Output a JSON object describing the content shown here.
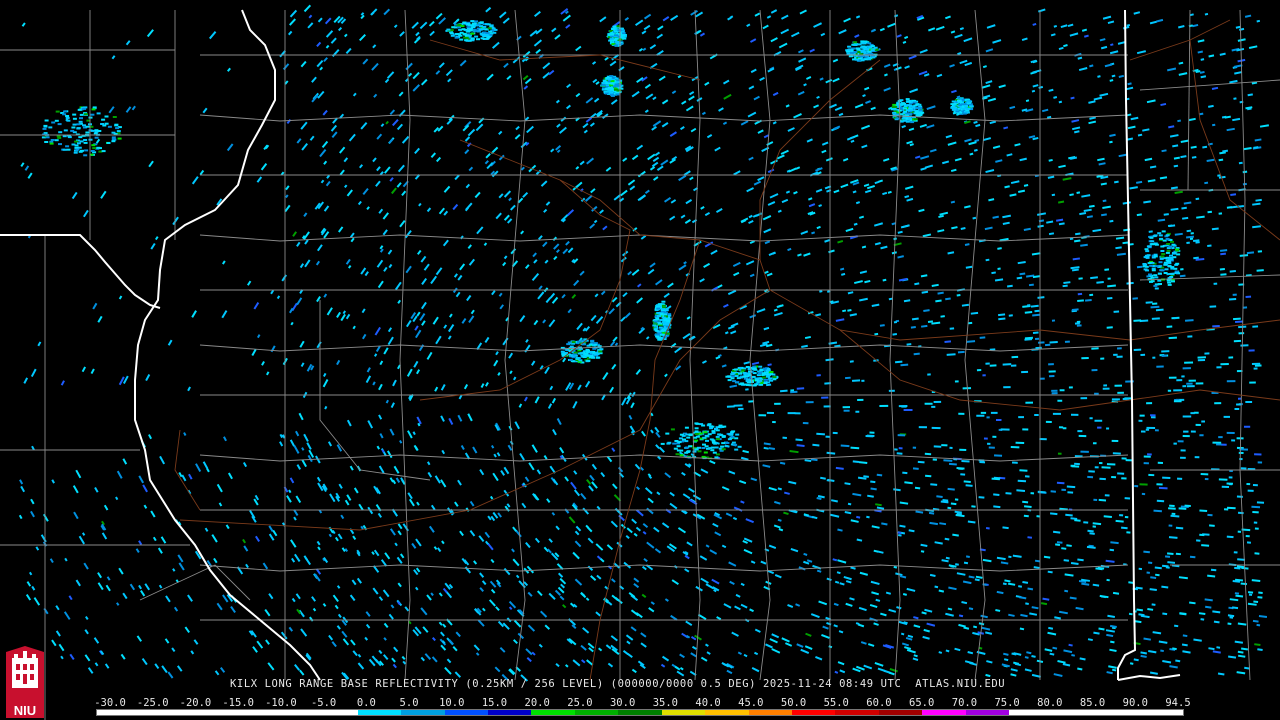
{
  "product": {
    "caption": "KILX LONG RANGE BASE REFLECTIVITY (0.25KM / 256 LEVEL) (000000/0000 0.5 DEG) 2025-11-24 08:49 UTC  ATLAS.NIU.EDU",
    "station": "KILX",
    "valid_time": "2025-11-24 08:49 UTC",
    "source": "ATLAS.NIU.EDU"
  },
  "logo": {
    "text": "NIU",
    "colors": [
      "#c8102e",
      "#ffffff"
    ]
  },
  "colorscale": {
    "labels": [
      "-30.0",
      "-25.0",
      "-20.0",
      "-15.0",
      "-10.0",
      "-5.0",
      "0.0",
      "5.0",
      "10.0",
      "15.0",
      "20.0",
      "25.0",
      "30.0",
      "35.0",
      "40.0",
      "45.0",
      "50.0",
      "55.0",
      "60.0",
      "65.0",
      "70.0",
      "75.0",
      "80.0",
      "85.0",
      "90.0",
      "94.5"
    ],
    "segment_colors": [
      "#ffffff",
      "#ffffff",
      "#ffffff",
      "#ffffff",
      "#ffffff",
      "#ffffff",
      "#00e0ff",
      "#00a0e0",
      "#0050ff",
      "#0000c8",
      "#00e000",
      "#00b000",
      "#008000",
      "#e0e000",
      "#ffc000",
      "#ff8000",
      "#ff0000",
      "#d00000",
      "#a00000",
      "#ff00ff",
      "#a000e0",
      "#ffffff",
      "#ffffff",
      "#ffffff",
      "#ffffff"
    ]
  },
  "map_colors": {
    "background": "#000000",
    "county_lines": "#8a8a8a",
    "state_lines": "#ffffff",
    "highways": "#7a3a1a",
    "echo_colors": [
      "#00c8ff",
      "#00e0ff",
      "#0090e0",
      "#1e5cff",
      "#00a000",
      "#00e000"
    ]
  }
}
